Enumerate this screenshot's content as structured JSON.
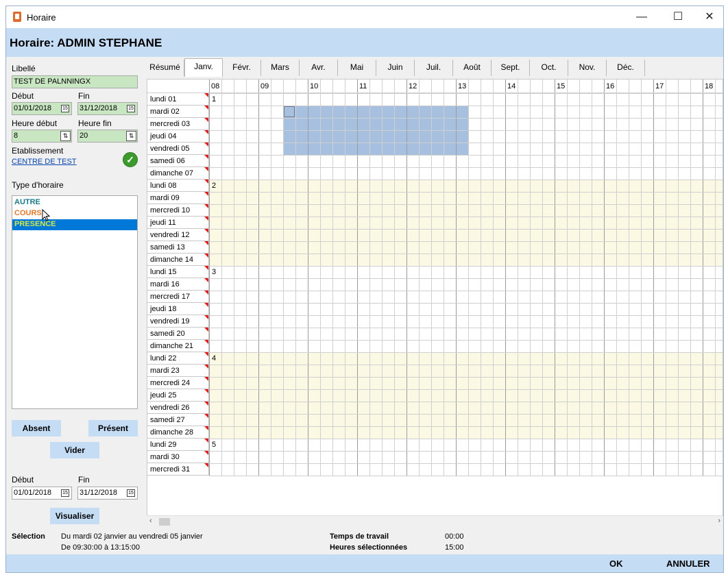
{
  "window": {
    "title": "Horaire",
    "minimize": "—",
    "maximize": "☐",
    "close": "✕"
  },
  "header": {
    "title": "Horaire: ADMIN STEPHANE"
  },
  "form": {
    "libelle_label": "Libellé",
    "libelle_value": "TEST DE PALNNINGX",
    "debut_label": "Début",
    "debut_value": "01/01/2018",
    "fin_label": "Fin",
    "fin_value": "31/12/2018",
    "heure_debut_label": "Heure début",
    "heure_debut_value": "8",
    "heure_fin_label": "Heure fin",
    "heure_fin_value": "20",
    "etablissement_label": "Etablissement",
    "etablissement_value": "CENTRE DE TEST",
    "type_label": "Type d'horaire",
    "types": [
      {
        "label": "AUTRE",
        "color": "#1a7a8a"
      },
      {
        "label": "COURS",
        "color": "#e07a2a"
      },
      {
        "label": "PRESENCE",
        "color": "#d4e84a",
        "selected": true
      }
    ],
    "absent_button": "Absent",
    "present_button": "Présent",
    "vider_button": "Vider",
    "debut2_label": "Début",
    "debut2_value": "01/01/2018",
    "fin2_label": "Fin",
    "fin2_value": "31/12/2018",
    "visualiser_button": "Visualiser"
  },
  "tabs": [
    "Résumé",
    "Janv.",
    "Févr.",
    "Mars",
    "Avr.",
    "Mai",
    "Juin",
    "Juil.",
    "Août",
    "Sept.",
    "Oct.",
    "Nov.",
    "Déc."
  ],
  "active_tab": "Janv.",
  "hours": [
    "08",
    "09",
    "10",
    "11",
    "12",
    "13",
    "14",
    "15",
    "16",
    "17",
    "18"
  ],
  "days": [
    "lundi 01",
    "mardi 02",
    "mercredi 03",
    "jeudi 04",
    "vendredi 05",
    "samedi 06",
    "dimanche 07",
    "lundi 08",
    "mardi 09",
    "mercredi 10",
    "jeudi 11",
    "vendredi 12",
    "samedi 13",
    "dimanche 14",
    "lundi 15",
    "mardi 16",
    "mercredi 17",
    "jeudi 18",
    "vendredi 19",
    "samedi 20",
    "dimanche 21",
    "lundi 22",
    "mardi 23",
    "mercredi 24",
    "jeudi 25",
    "vendredi 26",
    "samedi 27",
    "dimanche 28",
    "lundi 29",
    "mardi 30",
    "mercredi 31"
  ],
  "week_numbers": [
    "1",
    "2",
    "3",
    "4",
    "5"
  ],
  "selection": {
    "label": "Sélection",
    "line1": "Du mardi 02 janvier au vendredi 05 janvier",
    "line2": "De 09:30:00 à 13:15:00",
    "temps_label": "Temps de travail",
    "temps_value": "00:00",
    "heures_label": "Heures sélectionnées",
    "heures_value": "15:00"
  },
  "footer": {
    "ok": "OK",
    "annuler": "ANNULER"
  },
  "colors": {
    "header": "#c5dcf5",
    "selection": "#a8c0e0",
    "week_band": "#fbf9e3",
    "green_field": "#c9e6c2"
  }
}
